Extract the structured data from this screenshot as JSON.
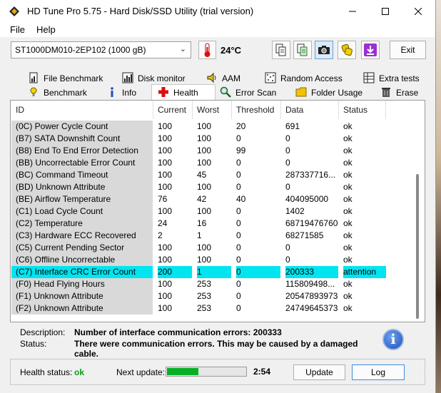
{
  "window": {
    "title": "HD Tune Pro 5.75 - Hard Disk/SSD Utility (trial version)"
  },
  "menu": {
    "file": "File",
    "help": "Help"
  },
  "toolbar": {
    "drive": "ST1000DM010-2EP102 (1000 gB)",
    "temperature": "24°C",
    "exit_label": "Exit",
    "icons": [
      "copy-icon",
      "copy-all-icon",
      "camera-icon",
      "options-icon",
      "download-icon"
    ]
  },
  "tabs": {
    "row1": [
      {
        "label": "File Benchmark",
        "icon": "file-benchmark-icon"
      },
      {
        "label": "Disk monitor",
        "icon": "disk-monitor-icon"
      },
      {
        "label": "AAM",
        "icon": "speaker-icon"
      },
      {
        "label": "Random Access",
        "icon": "random-access-icon"
      },
      {
        "label": "Extra tests",
        "icon": "extra-tests-icon"
      }
    ],
    "row2": [
      {
        "label": "Benchmark",
        "icon": "benchmark-icon"
      },
      {
        "label": "Info",
        "icon": "info-icon"
      },
      {
        "label": "Health",
        "icon": "health-cross-icon"
      },
      {
        "label": "Error Scan",
        "icon": "magnifier-icon"
      },
      {
        "label": "Folder Usage",
        "icon": "folder-icon"
      },
      {
        "label": "Erase",
        "icon": "trash-icon"
      }
    ],
    "active": "Health"
  },
  "table": {
    "columns": [
      "ID",
      "Current",
      "Worst",
      "Threshold",
      "Data",
      "Status"
    ],
    "rows": [
      [
        "(0C) Power Cycle Count",
        "100",
        "100",
        "20",
        "691",
        "ok"
      ],
      [
        "(B7) SATA Downshift Count",
        "100",
        "100",
        "0",
        "0",
        "ok"
      ],
      [
        "(B8) End To End Error Detection",
        "100",
        "100",
        "99",
        "0",
        "ok"
      ],
      [
        "(BB) Uncorrectable Error Count",
        "100",
        "100",
        "0",
        "0",
        "ok"
      ],
      [
        "(BC) Command Timeout",
        "100",
        "45",
        "0",
        "287337716...",
        "ok"
      ],
      [
        "(BD) Unknown Attribute",
        "100",
        "100",
        "0",
        "0",
        "ok"
      ],
      [
        "(BE) Airflow Temperature",
        "76",
        "42",
        "40",
        "404095000",
        "ok"
      ],
      [
        "(C1) Load Cycle Count",
        "100",
        "100",
        "0",
        "1402",
        "ok"
      ],
      [
        "(C2) Temperature",
        "24",
        "16",
        "0",
        "68719476760",
        "ok"
      ],
      [
        "(C3) Hardware ECC Recovered",
        "2",
        "1",
        "0",
        "68271585",
        "ok"
      ],
      [
        "(C5) Current Pending Sector",
        "100",
        "100",
        "0",
        "0",
        "ok"
      ],
      [
        "(C6) Offline Uncorrectable",
        "100",
        "100",
        "0",
        "0",
        "ok"
      ],
      [
        "(C7) Interface CRC Error Count",
        "200",
        "1",
        "0",
        "200333",
        "attention"
      ],
      [
        "(F0) Head Flying Hours",
        "100",
        "253",
        "0",
        "115809498...",
        "ok"
      ],
      [
        "(F1) Unknown Attribute",
        "100",
        "253",
        "0",
        "20547893973",
        "ok"
      ],
      [
        "(F2) Unknown Attribute",
        "100",
        "253",
        "0",
        "24749645373",
        "ok"
      ]
    ],
    "selected_row": 12
  },
  "details": {
    "description_label": "Description:",
    "description": "Number of interface communication errors: 200333",
    "status_label": "Status:",
    "status_line1": "There were communication errors. This may be caused by a damaged",
    "status_line2": "cable."
  },
  "footer": {
    "health_label": "Health status:",
    "health_value": "ok",
    "next_update_label": "Next update:",
    "countdown": "2:54",
    "progress": 0.4,
    "update_label": "Update",
    "log_label": "Log"
  },
  "colors": {
    "selection": "#00e5f0",
    "ok_green": "#06b025",
    "health_ok": "#0aa012"
  }
}
